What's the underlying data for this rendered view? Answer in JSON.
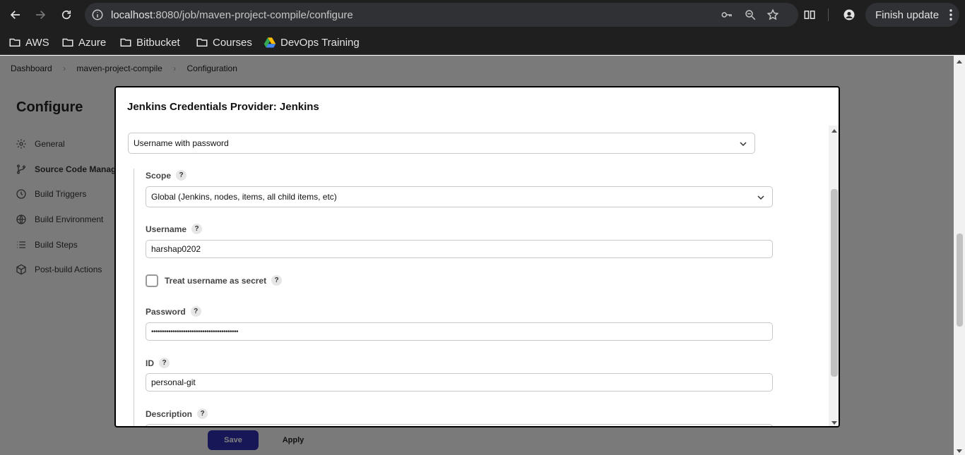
{
  "browser": {
    "url_host": "localhost",
    "url_path": ":8080/job/maven-project-compile/configure",
    "update_button": "Finish update"
  },
  "bookmarks": [
    {
      "label": "AWS",
      "icon": "folder-icon"
    },
    {
      "label": "Azure",
      "icon": "folder-icon"
    },
    {
      "label": "Bitbucket",
      "icon": "folder-icon"
    },
    {
      "label": "Courses",
      "icon": "folder-icon"
    },
    {
      "label": "DevOps Training",
      "icon": "drive-icon"
    }
  ],
  "breadcrumb": [
    "Dashboard",
    "maven-project-compile",
    "Configuration"
  ],
  "sidebar": {
    "title": "Configure",
    "items": [
      {
        "label": "General",
        "icon": "gear-icon"
      },
      {
        "label": "Source Code Manage",
        "icon": "branch-icon"
      },
      {
        "label": "Build Triggers",
        "icon": "clock-icon"
      },
      {
        "label": "Build Environment",
        "icon": "globe-icon"
      },
      {
        "label": "Build Steps",
        "icon": "list-icon"
      },
      {
        "label": "Post-build Actions",
        "icon": "package-icon"
      }
    ]
  },
  "footer": {
    "save_label": "Save",
    "apply_label": "Apply"
  },
  "dialog": {
    "title": "Jenkins Credentials Provider: Jenkins",
    "kind": "Username with password",
    "scope_label": "Scope",
    "scope_value": "Global (Jenkins, nodes, items, all child items, etc)",
    "username_label": "Username",
    "username_value": "harshap0202",
    "treat_secret_label": "Treat username as secret",
    "password_label": "Password",
    "password_value": "•••••••••••••••••••••••••••••••••••••••••",
    "id_label": "ID",
    "id_value": "personal-git",
    "description_label": "Description",
    "help_glyph": "?"
  },
  "colors": {
    "save_button": "#2f2fb0",
    "chrome": "#1f1f1f",
    "omnibox": "#303134"
  }
}
